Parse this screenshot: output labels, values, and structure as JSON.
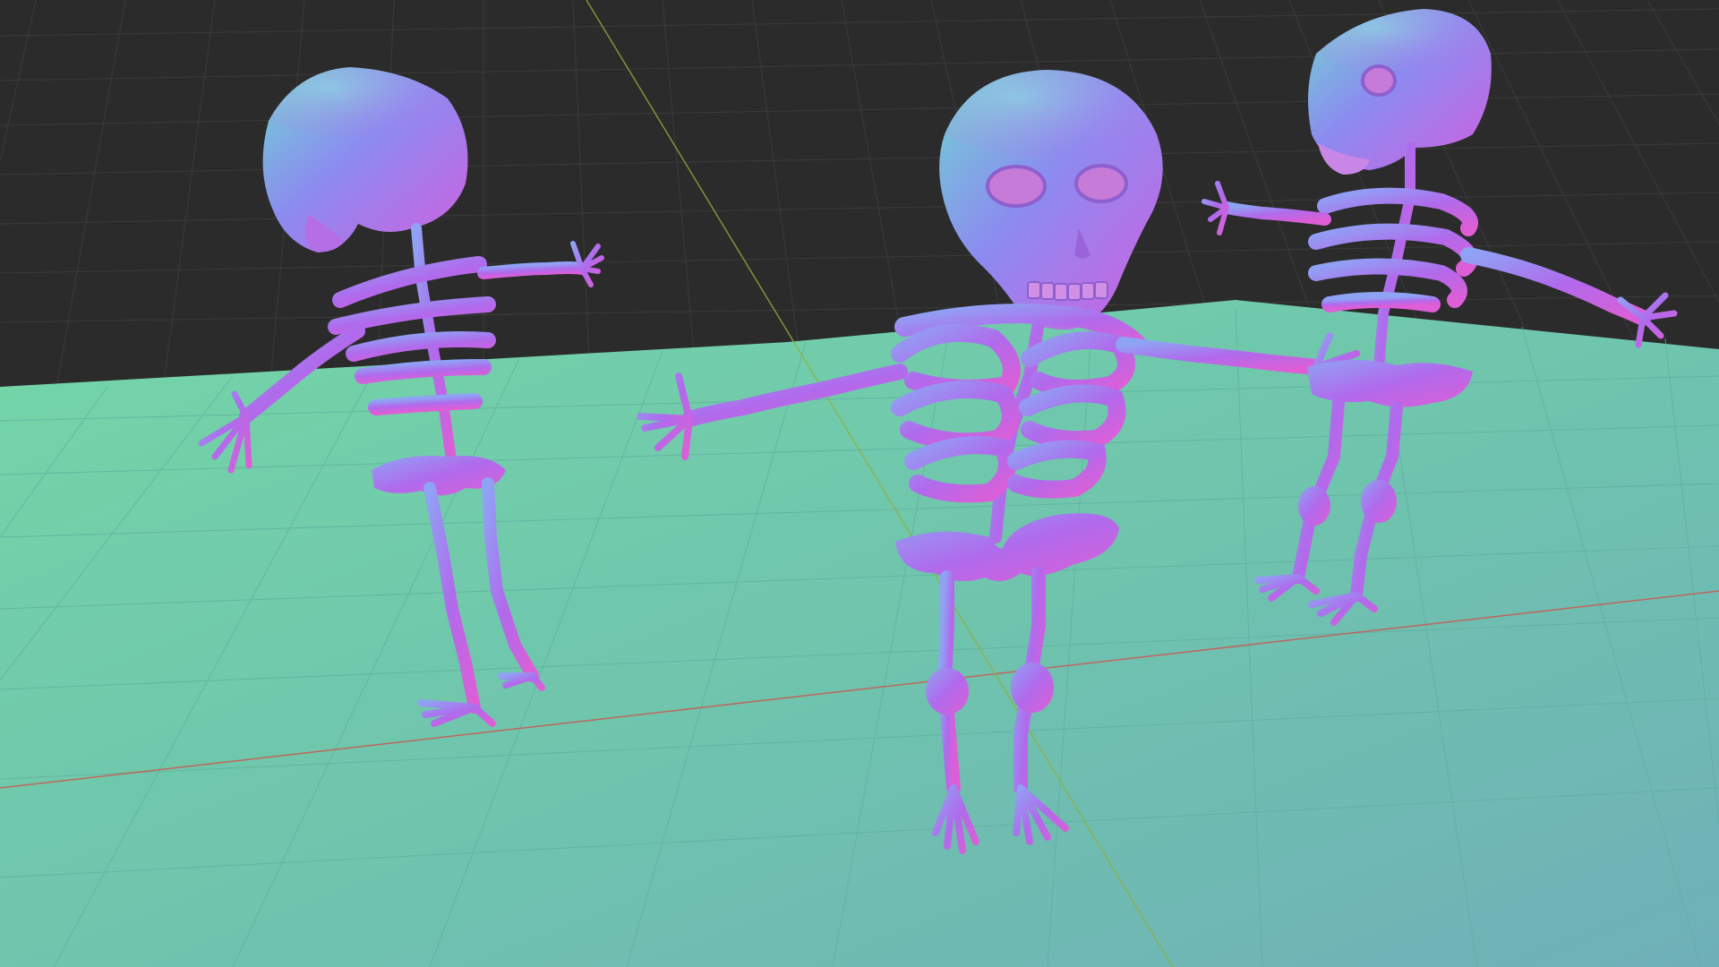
{
  "viewport": {
    "background_color": "#2b2b2b",
    "grid_line_color": "#3a3a3a",
    "floor_color_near": "#6fb7b4",
    "floor_color_far": "#74d6a7",
    "x_axis_color": "#d2504a",
    "y_axis_color": "#8fb03c"
  },
  "objects": [
    {
      "name": "skeleton-left",
      "shading": "normal-map"
    },
    {
      "name": "skeleton-center",
      "shading": "normal-map"
    },
    {
      "name": "skeleton-right",
      "shading": "normal-map"
    }
  ],
  "colors": {
    "normal_pink": "#d15fe0",
    "normal_blue": "#7f8bf0",
    "normal_cyan": "#6fd4d2",
    "normal_violet": "#a66fef"
  }
}
